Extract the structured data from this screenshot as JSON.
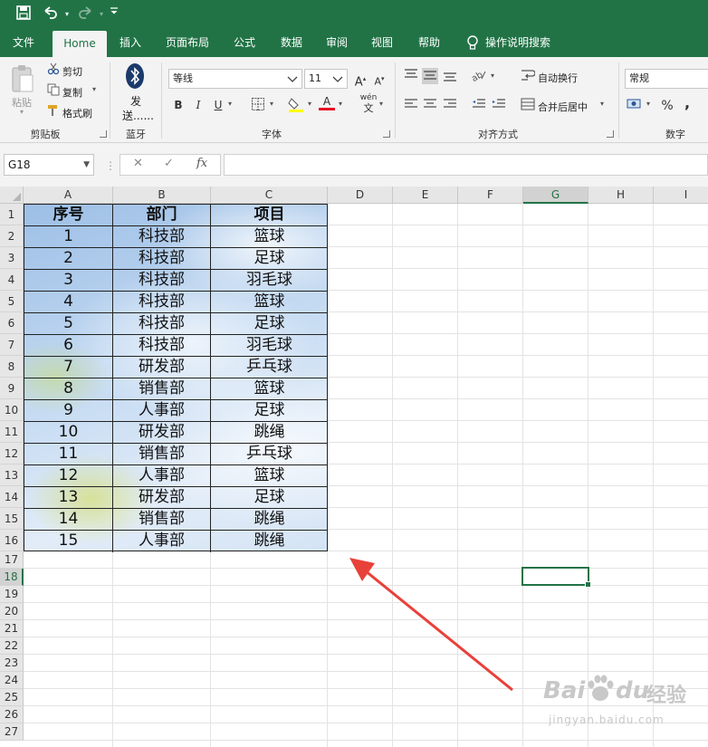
{
  "quick_access": {
    "save_icon": "save-icon",
    "undo_icon": "undo-icon",
    "redo_icon": "redo-icon",
    "customize_icon": "customize-icon"
  },
  "tabs": [
    "文件",
    "Home",
    "插入",
    "页面布局",
    "公式",
    "数据",
    "审阅",
    "视图",
    "帮助"
  ],
  "tell_me": "操作说明搜索",
  "clipboard": {
    "paste": "粘贴",
    "cut": "剪切",
    "copy": "复制",
    "format_painter": "格式刷",
    "group": "剪贴板"
  },
  "bluetooth": {
    "label_line1": "发",
    "label_line2": "送......",
    "group": "蓝牙"
  },
  "font": {
    "name": "等线",
    "size": "11",
    "group": "字体",
    "bold": "B",
    "italic": "I",
    "underline": "U",
    "grow": "A",
    "shrink": "A",
    "font_color": "A",
    "wen": "wén",
    "wen_char": "文"
  },
  "alignment": {
    "wrap_text": "自动换行",
    "merge_center": "合并后居中",
    "group": "对齐方式"
  },
  "number": {
    "format": "常规",
    "percent": "%",
    "comma": ",",
    "group": "数字"
  },
  "formula_bar": {
    "name_box": "G18",
    "fx": "fx",
    "formula": ""
  },
  "columns": [
    "A",
    "B",
    "C",
    "D",
    "E",
    "F",
    "G",
    "H",
    "I"
  ],
  "rows": [
    "1",
    "2",
    "3",
    "4",
    "5",
    "6",
    "7",
    "8",
    "9",
    "10",
    "11",
    "12",
    "13",
    "14",
    "15",
    "16",
    "17",
    "18",
    "19",
    "20",
    "21",
    "22",
    "23",
    "24",
    "25",
    "26",
    "27"
  ],
  "table": {
    "headers": [
      "序号",
      "部门",
      "项目"
    ],
    "data": [
      [
        "1",
        "科技部",
        "篮球"
      ],
      [
        "2",
        "科技部",
        "足球"
      ],
      [
        "3",
        "科技部",
        "羽毛球"
      ],
      [
        "4",
        "科技部",
        "篮球"
      ],
      [
        "5",
        "科技部",
        "足球"
      ],
      [
        "6",
        "科技部",
        "羽毛球"
      ],
      [
        "7",
        "研发部",
        "乒乓球"
      ],
      [
        "8",
        "销售部",
        "篮球"
      ],
      [
        "9",
        "人事部",
        "足球"
      ],
      [
        "10",
        "研发部",
        "跳绳"
      ],
      [
        "11",
        "销售部",
        "乒乓球"
      ],
      [
        "12",
        "人事部",
        "篮球"
      ],
      [
        "13",
        "研发部",
        "足球"
      ],
      [
        "14",
        "销售部",
        "跳绳"
      ],
      [
        "15",
        "人事部",
        "跳绳"
      ]
    ]
  },
  "selected_cell": "G18",
  "watermark": {
    "brand": "Bai",
    "du": "du",
    "jingyan": "经验",
    "url": "jingyan.baidu.com"
  },
  "colors": {
    "excel_green": "#217346",
    "arrow": "#e8413a"
  }
}
